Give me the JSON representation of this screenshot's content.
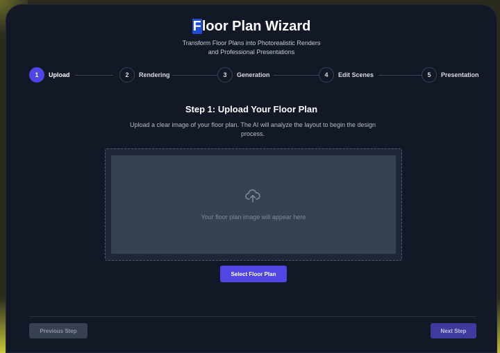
{
  "header": {
    "title_cursor_char": "F",
    "title_rest": "loor Plan Wizard",
    "subtitle_line1": "Transform Floor Plans into Photorealistic Renders",
    "subtitle_line2": "and Professional Presentations"
  },
  "stepper": {
    "steps": [
      {
        "number": "1",
        "label": "Upload",
        "active": true
      },
      {
        "number": "2",
        "label": "Rendering",
        "active": false
      },
      {
        "number": "3",
        "label": "Generation",
        "active": false
      },
      {
        "number": "4",
        "label": "Edit Scenes",
        "active": false
      },
      {
        "number": "5",
        "label": "Presentation",
        "active": false
      }
    ]
  },
  "content": {
    "title": "Step 1: Upload Your Floor Plan",
    "description": "Upload a clear image of your floor plan. The AI will analyze the layout to begin the design process.",
    "preview_placeholder": "Your floor plan image will appear here",
    "upload_icon": "cloud-upload-icon",
    "select_button": "Select Floor Plan"
  },
  "footer": {
    "previous_label": "Previous Step",
    "next_label": "Next Step"
  },
  "colors": {
    "accent": "#4f46e5",
    "background": "#121826",
    "preview": "#364152"
  }
}
